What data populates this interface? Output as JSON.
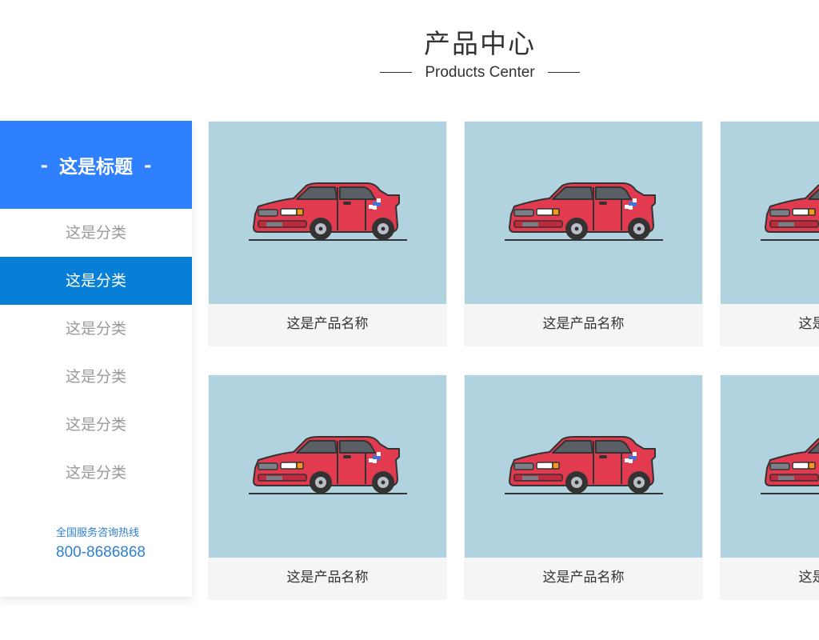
{
  "section": {
    "title": "产品中心",
    "subtitle": "Products Center"
  },
  "sidebar": {
    "title": "这是标题",
    "title_dash": "-",
    "categories": [
      {
        "label": "这是分类",
        "active": false
      },
      {
        "label": "这是分类",
        "active": true
      },
      {
        "label": "这是分类",
        "active": false
      },
      {
        "label": "这是分类",
        "active": false
      },
      {
        "label": "这是分类",
        "active": false
      },
      {
        "label": "这是分类",
        "active": false
      }
    ],
    "hotline_label": "全国服务咨询热线",
    "hotline_number": "800-8686868"
  },
  "products": [
    {
      "name": "这是产品名称",
      "image_icon": "red-car-icon"
    },
    {
      "name": "这是产品名称",
      "image_icon": "red-car-icon"
    },
    {
      "name": "这是产品名称",
      "image_icon": "red-car-icon"
    },
    {
      "name": "这是产品名称",
      "image_icon": "red-car-icon"
    },
    {
      "name": "这是产品名称",
      "image_icon": "red-car-icon"
    },
    {
      "name": "这是产品名称",
      "image_icon": "red-car-icon"
    }
  ],
  "colors": {
    "sidebar_title_bg": "#2f80fe",
    "active_category_bg": "#077fd6",
    "product_image_bg": "#b0d3df",
    "hotline_text": "#2f80d0"
  }
}
